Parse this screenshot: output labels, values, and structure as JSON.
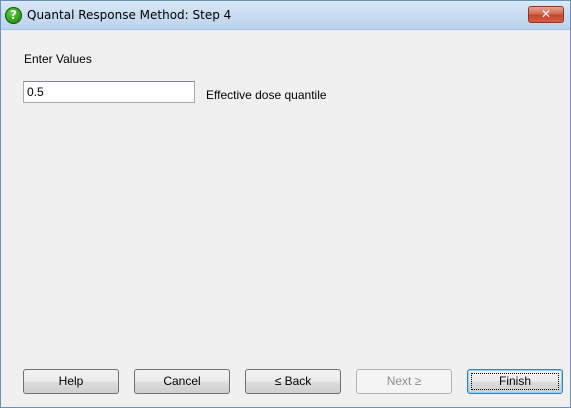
{
  "window": {
    "title": "Quantal Response Method: Step 4",
    "icon": "help-question-icon",
    "close_glyph": "✕"
  },
  "form": {
    "section_label": "Enter Values",
    "quantile": {
      "value": "0.5",
      "label": "Effective dose quantile"
    }
  },
  "buttons": {
    "help": "Help",
    "cancel": "Cancel",
    "back": "≤ Back",
    "next": "Next ≥",
    "finish": "Finish"
  },
  "colors": {
    "title_bar": "#c9dcf1",
    "close_button": "#c4452c",
    "dialog_bg": "#f0f0f0",
    "help_icon": "#2e9a1c"
  }
}
